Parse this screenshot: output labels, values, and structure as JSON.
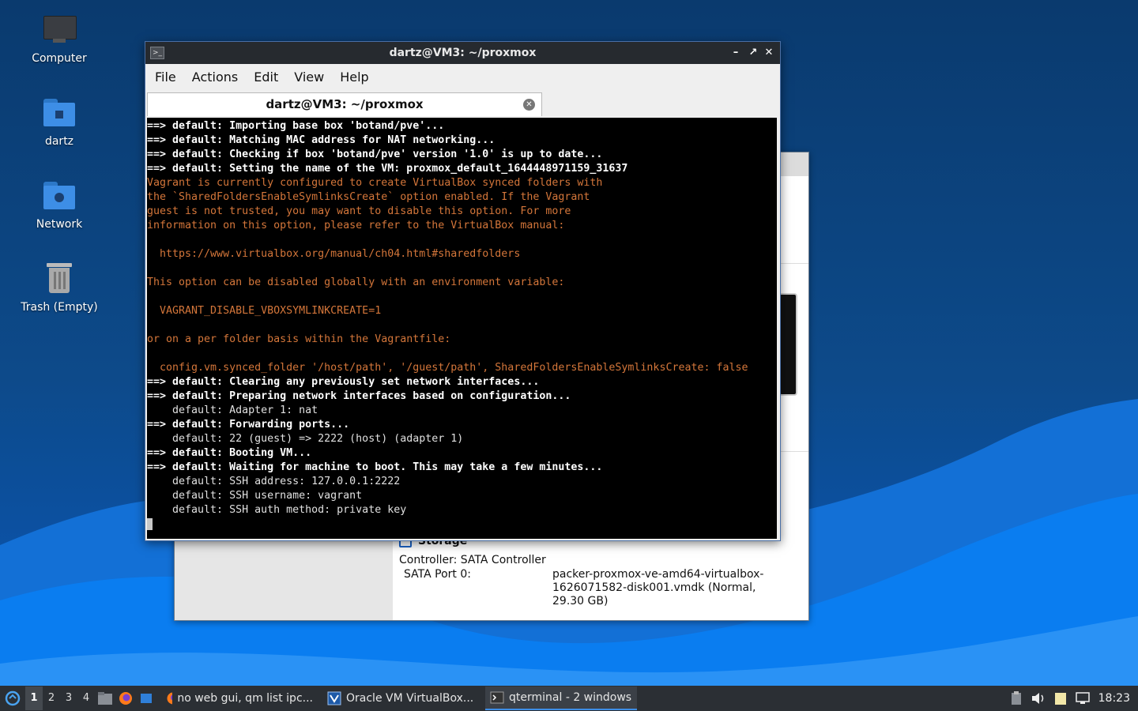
{
  "desktop": {
    "icons": [
      {
        "label": "Computer"
      },
      {
        "label": "dartz"
      },
      {
        "label": "Network"
      },
      {
        "label": "Trash (Empty)"
      }
    ]
  },
  "vbox_window": {
    "storage_header": "Storage",
    "controller": "Controller: SATA Controller",
    "port_label": "SATA Port 0:",
    "port_value": "packer-proxmox-ve-amd64-virtualbox-1626071582-disk001.vmdk (Normal, 29.30 GB)"
  },
  "terminal": {
    "title": "dartz@VM3: ~/proxmox",
    "menu": [
      "File",
      "Actions",
      "Edit",
      "View",
      "Help"
    ],
    "tab_label": "dartz@VM3: ~/proxmox",
    "lines": [
      {
        "style": "bold",
        "text": "==> default: Importing base box 'botand/pve'..."
      },
      {
        "style": "bold",
        "text": "==> default: Matching MAC address for NAT networking..."
      },
      {
        "style": "bold",
        "text": "==> default: Checking if box 'botand/pve' version '1.0' is up to date..."
      },
      {
        "style": "bold",
        "text": "==> default: Setting the name of the VM: proxmox_default_1644448971159_31637"
      },
      {
        "style": "orange",
        "text": "Vagrant is currently configured to create VirtualBox synced folders with"
      },
      {
        "style": "orange",
        "text": "the `SharedFoldersEnableSymlinksCreate` option enabled. If the Vagrant"
      },
      {
        "style": "orange",
        "text": "guest is not trusted, you may want to disable this option. For more"
      },
      {
        "style": "orange",
        "text": "information on this option, please refer to the VirtualBox manual:"
      },
      {
        "style": "orange",
        "text": ""
      },
      {
        "style": "orange",
        "text": "  https://www.virtualbox.org/manual/ch04.html#sharedfolders"
      },
      {
        "style": "orange",
        "text": ""
      },
      {
        "style": "orange",
        "text": "This option can be disabled globally with an environment variable:"
      },
      {
        "style": "orange",
        "text": ""
      },
      {
        "style": "orange",
        "text": "  VAGRANT_DISABLE_VBOXSYMLINKCREATE=1"
      },
      {
        "style": "orange",
        "text": ""
      },
      {
        "style": "orange",
        "text": "or on a per folder basis within the Vagrantfile:"
      },
      {
        "style": "orange",
        "text": ""
      },
      {
        "style": "orange",
        "text": "  config.vm.synced_folder '/host/path', '/guest/path', SharedFoldersEnableSymlinksCreate: false"
      },
      {
        "style": "bold",
        "text": "==> default: Clearing any previously set network interfaces..."
      },
      {
        "style": "bold",
        "text": "==> default: Preparing network interfaces based on configuration..."
      },
      {
        "style": "plain",
        "text": "    default: Adapter 1: nat"
      },
      {
        "style": "bold",
        "text": "==> default: Forwarding ports..."
      },
      {
        "style": "plain",
        "text": "    default: 22 (guest) => 2222 (host) (adapter 1)"
      },
      {
        "style": "bold",
        "text": "==> default: Booting VM..."
      },
      {
        "style": "bold",
        "text": "==> default: Waiting for machine to boot. This may take a few minutes..."
      },
      {
        "style": "plain",
        "text": "    default: SSH address: 127.0.0.1:2222"
      },
      {
        "style": "plain",
        "text": "    default: SSH username: vagrant"
      },
      {
        "style": "plain",
        "text": "    default: SSH auth method: private key"
      }
    ]
  },
  "taskbar": {
    "desktops": [
      "1",
      "2",
      "3",
      "4"
    ],
    "tasks": [
      {
        "label": "no web gui, qm list ipc...",
        "icon": "firefox-icon"
      },
      {
        "label": "Oracle VM VirtualBox...",
        "icon": "virtualbox-icon"
      },
      {
        "label": "qterminal - 2 windows",
        "icon": "terminal-icon"
      }
    ],
    "clock": "18:23"
  },
  "colors": {
    "terminal_orange": "#d4763a",
    "taskbar_bg": "#2b2f34",
    "accent": "#3d8ee6"
  }
}
